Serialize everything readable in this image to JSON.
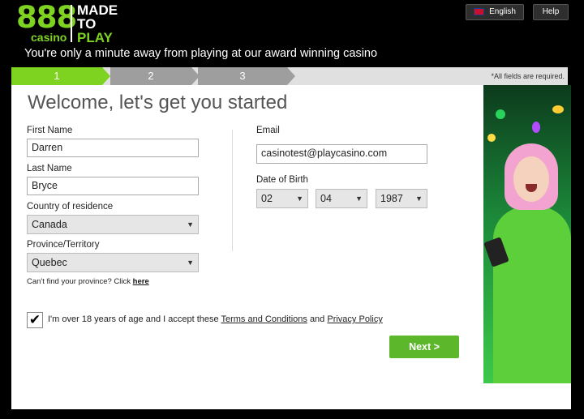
{
  "header": {
    "logo_number": "888",
    "logo_casino": "casino",
    "made_line1": "MADE",
    "made_line2": "TO",
    "made_line3": "PLAY",
    "tagline": "You're only a minute away from playing at our award winning casino",
    "language_button": "English",
    "help_button": "Help"
  },
  "steps": {
    "items": [
      "1",
      "2",
      "3"
    ],
    "required_note": "*All fields are required."
  },
  "form": {
    "title": "Welcome, let's get you started",
    "first_name_label": "First Name",
    "first_name_value": "Darren",
    "last_name_label": "Last Name",
    "last_name_value": "Bryce",
    "country_label": "Country of residence",
    "country_value": "Canada",
    "province_label": "Province/Territory",
    "province_value": "Quebec",
    "province_help": "Can't find your province? Click",
    "province_help_link": "here",
    "email_label": "Email",
    "email_value": "casinotest@playcasino.com",
    "dob_label": "Date of Birth",
    "dob_day": "02",
    "dob_month": "04",
    "dob_year": "1987",
    "consent_prefix": "I'm over 18 years of age and I accept these",
    "consent_terms": "Terms and Conditions",
    "consent_and": "and",
    "consent_privacy": "Privacy Policy",
    "consent_checked": true,
    "next_button": "Next >"
  },
  "colors": {
    "brand_green": "#7ed321",
    "button_green": "#5cb82a",
    "step_inactive": "#9e9e9e"
  }
}
